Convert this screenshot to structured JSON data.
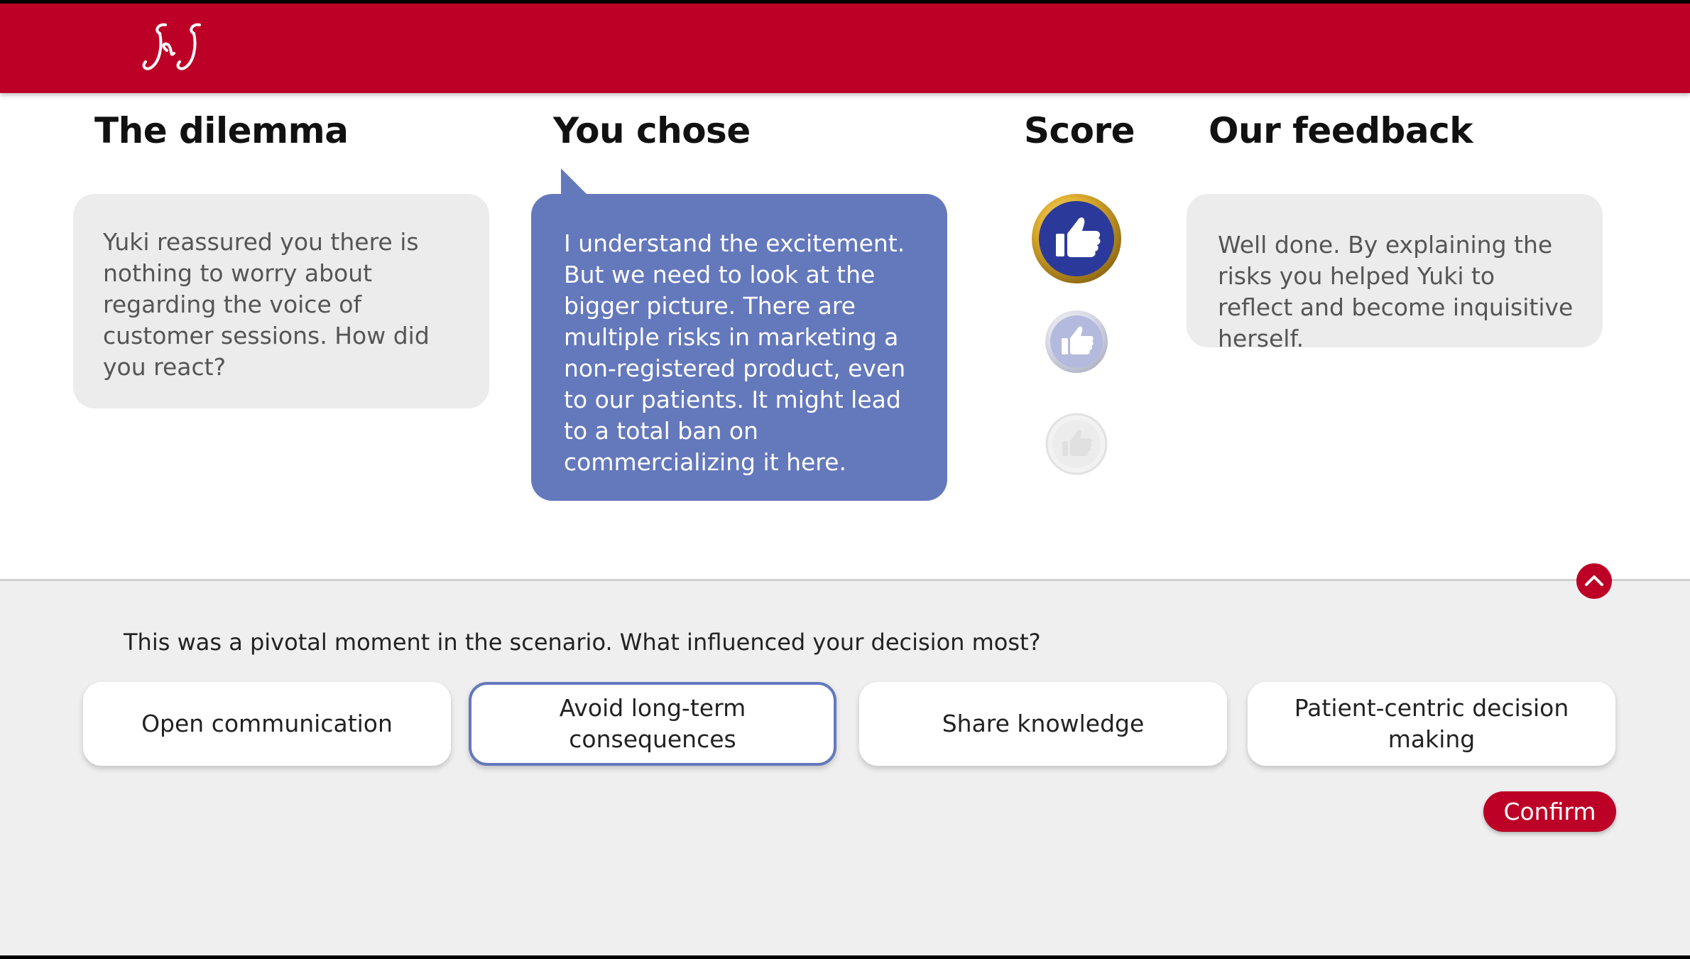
{
  "header": {
    "logo_text": "J&J",
    "brand_color": "#bd0026"
  },
  "columns": {
    "dilemma_title": "The dilemma",
    "choice_title": "You chose",
    "score_title": "Score",
    "feedback_title": "Our feedback"
  },
  "dilemma": {
    "text": "Yuki reassured you there is nothing to worry about regarding the voice of customer sessions. How did you react?"
  },
  "choice": {
    "text": "I understand the excitement. But we need to look at the bigger picture. There are multiple risks in marketing a non-registered product, even to our patients. It might lead to a total ban on commercializing it here."
  },
  "score": {
    "icons": [
      "thumbs-up-gold",
      "thumbs-up-silver",
      "thumbs-up-faded"
    ],
    "achieved": 1
  },
  "feedback": {
    "text": "Well done. By explaining the risks you helped Yuki to reflect and become inquisitive herself."
  },
  "reflection": {
    "question": "This was a pivotal moment in the scenario. What influenced your decision most?",
    "options": [
      {
        "label": "Open communication",
        "selected": false
      },
      {
        "label": "Avoid long-term consequences",
        "selected": true
      },
      {
        "label": "Share knowledge",
        "selected": false
      },
      {
        "label": "Patient-centric decision making",
        "selected": false
      }
    ],
    "confirm_label": "Confirm"
  },
  "colors": {
    "accent": "#6478bc",
    "card_bg": "#ececec",
    "panel_bg": "#efefef"
  }
}
